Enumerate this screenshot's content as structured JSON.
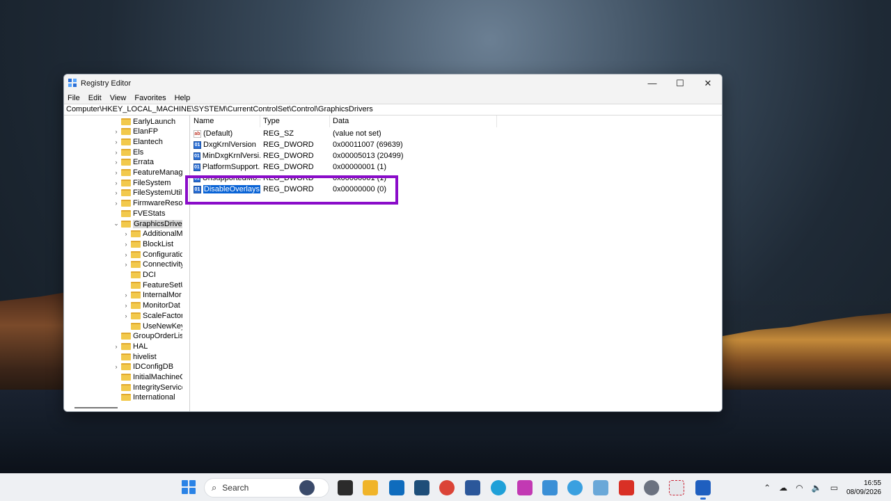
{
  "window": {
    "title": "Registry Editor",
    "controls": {
      "minimize": "—",
      "maximize": "☐",
      "close": "✕"
    }
  },
  "menu": [
    "File",
    "Edit",
    "View",
    "Favorites",
    "Help"
  ],
  "address": "Computer\\HKEY_LOCAL_MACHINE\\SYSTEM\\CurrentControlSet\\Control\\GraphicsDrivers",
  "tree": [
    {
      "label": "EarlyLaunch",
      "level": 1,
      "expander": ""
    },
    {
      "label": "ElanFP",
      "level": 1,
      "expander": "›"
    },
    {
      "label": "Elantech",
      "level": 1,
      "expander": "›"
    },
    {
      "label": "Els",
      "level": 1,
      "expander": "›"
    },
    {
      "label": "Errata",
      "level": 1,
      "expander": "›"
    },
    {
      "label": "FeatureManag",
      "level": 1,
      "expander": "›"
    },
    {
      "label": "FileSystem",
      "level": 1,
      "expander": "›"
    },
    {
      "label": "FileSystemUtili",
      "level": 1,
      "expander": "›"
    },
    {
      "label": "FirmwareResou",
      "level": 1,
      "expander": "›"
    },
    {
      "label": "FVEStats",
      "level": 1,
      "expander": ""
    },
    {
      "label": "GraphicsDriver",
      "level": 1,
      "expander": "⌄",
      "selected": true
    },
    {
      "label": "AdditionalM",
      "level": 2,
      "expander": "›"
    },
    {
      "label": "BlockList",
      "level": 2,
      "expander": "›"
    },
    {
      "label": "Configuratic",
      "level": 2,
      "expander": "›"
    },
    {
      "label": "Connectivity",
      "level": 2,
      "expander": "›"
    },
    {
      "label": "DCI",
      "level": 2,
      "expander": ""
    },
    {
      "label": "FeatureSetU",
      "level": 2,
      "expander": ""
    },
    {
      "label": "InternalMor",
      "level": 2,
      "expander": "›"
    },
    {
      "label": "MonitorDat",
      "level": 2,
      "expander": "›"
    },
    {
      "label": "ScaleFactor",
      "level": 2,
      "expander": "›"
    },
    {
      "label": "UseNewKey",
      "level": 2,
      "expander": ""
    },
    {
      "label": "GroupOrderLis",
      "level": 1,
      "expander": ""
    },
    {
      "label": "HAL",
      "level": 1,
      "expander": "›"
    },
    {
      "label": "hivelist",
      "level": 1,
      "expander": ""
    },
    {
      "label": "IDConfigDB",
      "level": 1,
      "expander": "›"
    },
    {
      "label": "InitialMachineC",
      "level": 1,
      "expander": ""
    },
    {
      "label": "IntegrityService",
      "level": 1,
      "expander": ""
    },
    {
      "label": "International",
      "level": 1,
      "expander": ""
    }
  ],
  "list": {
    "headers": {
      "name": "Name",
      "type": "Type",
      "data": "Data"
    },
    "rows": [
      {
        "name": "(Default)",
        "type": "REG_SZ",
        "data": "(value not set)",
        "icon": "ab",
        "kind": "sz"
      },
      {
        "name": "DxgKrnlVersion",
        "type": "REG_DWORD",
        "data": "0x00011007 (69639)",
        "icon": "01",
        "kind": "dw"
      },
      {
        "name": "MinDxgKrnlVersi...",
        "type": "REG_DWORD",
        "data": "0x00005013 (20499)",
        "icon": "01",
        "kind": "dw"
      },
      {
        "name": "PlatformSupport...",
        "type": "REG_DWORD",
        "data": "0x00000001 (1)",
        "icon": "01",
        "kind": "dw"
      },
      {
        "name": "UnsupportedMo...",
        "type": "REG_DWORD",
        "data": "0x00000001 (1)",
        "icon": "01",
        "kind": "dw",
        "partial": true
      },
      {
        "name": "DisableOverlays",
        "type": "REG_DWORD",
        "data": "0x00000000 (0)",
        "icon": "01",
        "kind": "dw",
        "selected": true
      }
    ]
  },
  "taskbar": {
    "search_placeholder": "Search",
    "time": "16:55",
    "date": "08/09/2026",
    "tray_icons": [
      "chevron-up-icon",
      "network-icon",
      "wifi-icon",
      "volume-icon",
      "battery-icon"
    ]
  },
  "colors": {
    "highlight_box": "#8a0cc9",
    "selection": "#0a64d6"
  }
}
